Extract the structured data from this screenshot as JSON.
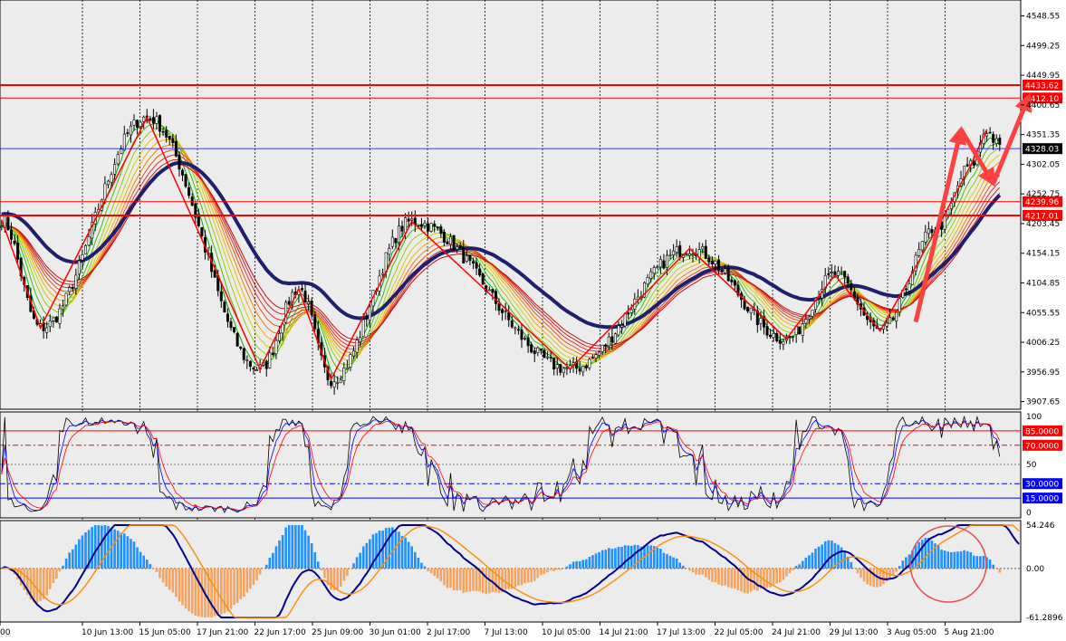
{
  "colors": {
    "background": "#ffffff",
    "pane": "#ececec",
    "grid": "#000000",
    "level_line": "#ff0000",
    "current_price_line": "#0000ff",
    "ma_thick": "#1f1f6e",
    "bull_body": "#ffffff",
    "bear_body": "#000000",
    "stoch_main": "#000000",
    "stoch_signal_1": "#0000ff",
    "stoch_signal_2": "#ff0000",
    "hist_pos": "#1e90ff",
    "hist_neg": "#f4a460",
    "macd_line": "#00008b",
    "signal_line": "#ff8c00",
    "arrow": "#ff4040",
    "highlight_circle": "#e05050"
  },
  "chart_data": [
    {
      "type": "candlestick",
      "pane": "price",
      "y_ticks": [
        "4548.55",
        "4499.25",
        "4449.95",
        "4400.65",
        "4351.35",
        "4302.05",
        "4252.75",
        "4203.45",
        "4154.15",
        "4104.85",
        "4055.55",
        "4006.25",
        "3956.95",
        "3907.65"
      ],
      "ylim": [
        3895,
        4575
      ],
      "time_labels": [
        "00",
        "10 Jun 13:00",
        "15 Jun 05:00",
        "17 Jun 21:00",
        "22 Jun 17:00",
        "25 Jun 09:00",
        "30 Jun 01:00",
        "2 Jul 17:00",
        "7 Jul 13:00",
        "10 Jul 05:00",
        "14 Jul 21:00",
        "17 Jul 13:00",
        "22 Jul 05:00",
        "24 Jul 21:00",
        "29 Jul 13:00",
        "3 Aug 05:00",
        "5 Aug 21:00"
      ],
      "zigzag_points": [
        {
          "i": 0,
          "price": 4210
        },
        {
          "i": 12,
          "price": 4030
        },
        {
          "i": 45,
          "price": 4380
        },
        {
          "i": 80,
          "price": 3962
        },
        {
          "i": 92,
          "price": 4095
        },
        {
          "i": 102,
          "price": 3945
        },
        {
          "i": 127,
          "price": 4207
        },
        {
          "i": 176,
          "price": 3962
        },
        {
          "i": 213,
          "price": 4162
        },
        {
          "i": 243,
          "price": 4012
        },
        {
          "i": 258,
          "price": 4118
        },
        {
          "i": 272,
          "price": 4025
        },
        {
          "i": 290,
          "price": 4200
        },
        {
          "i": 300,
          "price": 4300
        },
        {
          "i": 305,
          "price": 4360
        }
      ],
      "horizontal_levels": [
        {
          "price": "4433.62",
          "label": "4433.62",
          "style": "thick"
        },
        {
          "price": "4412.10",
          "label": "4412.10",
          "style": "thin"
        },
        {
          "price": "4239.96",
          "label": "4239.96",
          "style": "thin"
        },
        {
          "price": "4217.01",
          "label": "4217.01",
          "style": "thick"
        }
      ],
      "current_price": "4328.03",
      "arrows": [
        {
          "from": [
            283,
            4040
          ],
          "to": [
            297,
            4360
          ]
        },
        {
          "from": [
            297,
            4360
          ],
          "to": [
            307,
            4270
          ]
        },
        {
          "from": [
            307,
            4270
          ],
          "to": [
            318,
            4415
          ]
        }
      ]
    },
    {
      "type": "line",
      "pane": "stochastic",
      "y_ticks": [
        "100",
        "50",
        "0"
      ],
      "ylim": [
        0,
        100
      ],
      "levels": [
        {
          "value": "85.0000",
          "label": "85.0000",
          "style": "solid",
          "color": "#ff0000"
        },
        {
          "value": "70.0000",
          "label": "70.0000",
          "style": "dashdot",
          "color": "#ff0000"
        },
        {
          "value": "30.0000",
          "label": "30.0000",
          "style": "dashdot",
          "color": "#0000ff"
        },
        {
          "value": "15.0000",
          "label": "15.0000",
          "style": "solid",
          "color": "#0000ff"
        }
      ]
    },
    {
      "type": "bar",
      "pane": "macd",
      "y_ticks": [
        "54.246",
        "0.00",
        "-61.2896"
      ],
      "ylim": [
        -61.2896,
        54.246
      ]
    }
  ]
}
